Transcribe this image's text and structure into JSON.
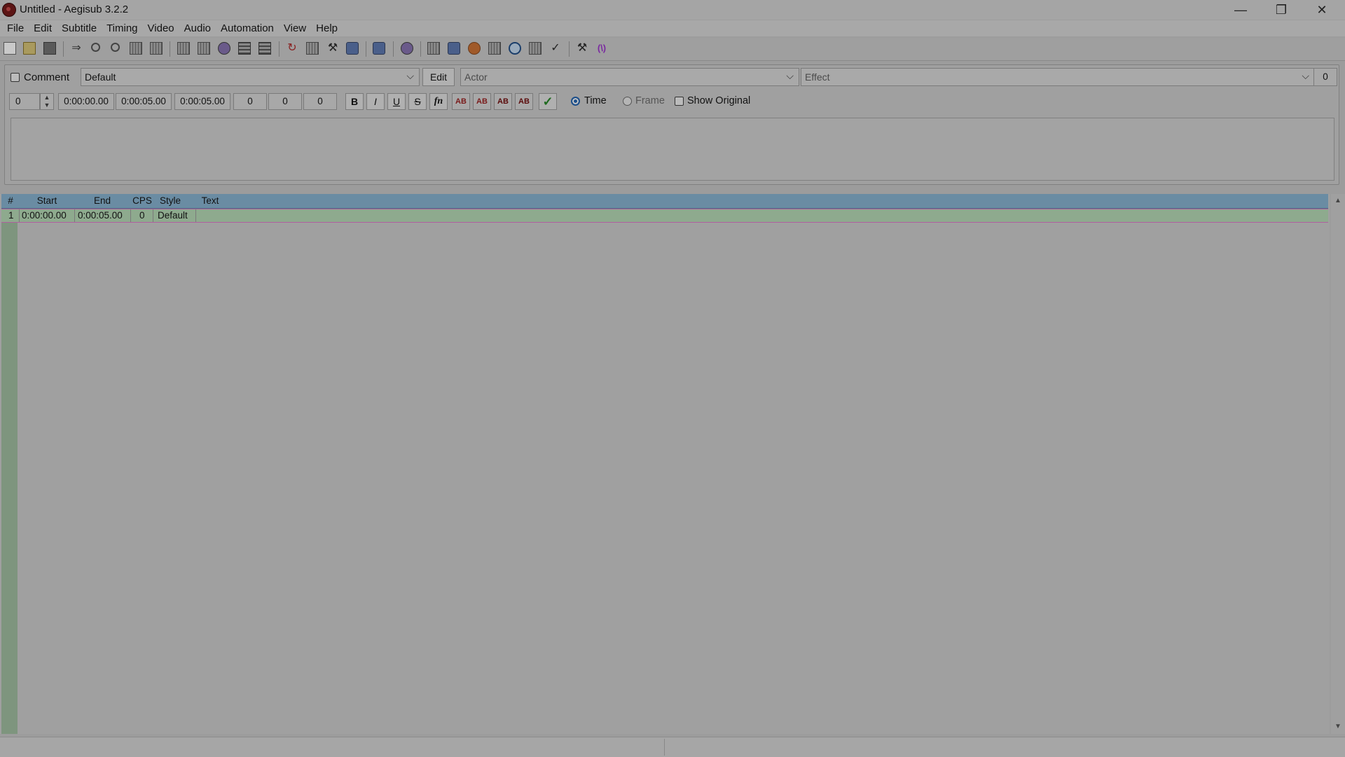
{
  "window": {
    "title": "Untitled - Aegisub 3.2.2",
    "minimize_glyph": "—",
    "restore_glyph": "❐",
    "close_glyph": "✕"
  },
  "menu": [
    "File",
    "Edit",
    "Subtitle",
    "Timing",
    "Video",
    "Audio",
    "Automation",
    "View",
    "Help"
  ],
  "toolbar": {
    "icons": [
      "new-file-icon",
      "open-folder-icon",
      "save-floppy-icon",
      "jump-icon",
      "find-icon",
      "find-replace-icon",
      "copy-icon",
      "paste-icon",
      "styles-icon",
      "properties-icon",
      "attachments-icon",
      "fonts-collector-icon",
      "video-film-icon",
      "resample-icon",
      "translation-icon",
      "spell-check-icon",
      "automation-icon",
      "color-sphere-icon",
      "timing-shift-icon",
      "snap-icon",
      "visual-typesetting-icon",
      "stop-icon",
      "timer-clock-icon",
      "kanji-timer-icon",
      "check-icon",
      "options-tools-icon",
      "macro-icon"
    ],
    "glyph_arrow": "⇒",
    "glyph_tools": "⚒",
    "glyph_macro": "(\\)",
    "glyph_red": "↻"
  },
  "edit": {
    "comment_label": "Comment",
    "style_value": "Default",
    "edit_button": "Edit",
    "actor_placeholder": "Actor",
    "effect_placeholder": "Effect",
    "char_count": "0",
    "layer_value": "0",
    "start_time": "0:00:00.00",
    "end_time": "0:00:05.00",
    "duration": "0:00:05.00",
    "margin_left": "0",
    "margin_right": "0",
    "margin_vertical": "0",
    "bold_label": "B",
    "italic_label": "I",
    "underline_label": "U",
    "strike_label": "S",
    "font_label": "fn",
    "color_label": "AB",
    "commit_glyph": "✓",
    "time_label": "Time",
    "frame_label": "Frame",
    "show_original_label": "Show Original",
    "arrow_glyph": "⌵",
    "spin_up": "▲",
    "spin_down": "▼"
  },
  "grid": {
    "columns": [
      "#",
      "Start",
      "End",
      "CPS",
      "Style",
      "Text"
    ],
    "rows": [
      {
        "num": "1",
        "start": "0:00:00.00",
        "end": "0:00:05.00",
        "cps": "0",
        "style": "Default",
        "text": ""
      }
    ],
    "scroll_up": "▲",
    "scroll_down": "▼"
  },
  "colors": {
    "accent": "#1d4f8a",
    "selected_row": "#8eaa8e",
    "header": "#6a8ca3"
  }
}
